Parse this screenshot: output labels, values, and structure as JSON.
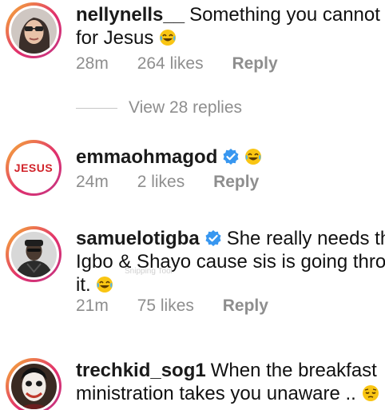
{
  "comments": [
    {
      "username": "nellynells__",
      "line1": "Something you cannot do",
      "line2": "for Jesus",
      "time": "28m",
      "likes": "264 likes",
      "reply": "Reply"
    },
    {
      "username": "emmaohmagod",
      "avatar_text": "JESUS",
      "time": "24m",
      "likes": "2 likes",
      "reply": "Reply"
    },
    {
      "username": "samuelotigba",
      "line1": "She really needs that",
      "line2": "Igbo & Shayo cause sis is going through",
      "line3": "it.",
      "time": "21m",
      "likes": "75 likes",
      "reply": "Reply"
    },
    {
      "username": "trechkid_sog1",
      "line1": "When the breakfast",
      "line2": "ministration takes you unaware .."
    }
  ],
  "view_replies": "View 28 replies",
  "watermark": "Snipping Tool",
  "colors": {
    "verified": "#3897f0",
    "meta_gray": "#8e8e8e",
    "ring_start": "#f7b733",
    "ring_end": "#c13584"
  }
}
